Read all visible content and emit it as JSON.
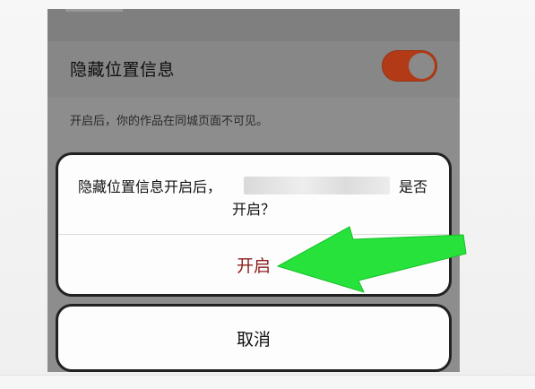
{
  "setting": {
    "label": "隐藏位置信息",
    "toggle_on": true,
    "hint": "开启后，你的作品在同城页面不可见。"
  },
  "dialog": {
    "message_start": "隐藏位置信息开启后，",
    "message_end": "是否",
    "message_line2": "开启？",
    "confirm_label": "开启"
  },
  "cancel": {
    "label": "取消"
  },
  "colors": {
    "toggle_on": "#b33a17",
    "confirm_text": "#8b1e1e",
    "arrow": "#27e23a"
  },
  "bottom_strip": {
    "text": ""
  }
}
